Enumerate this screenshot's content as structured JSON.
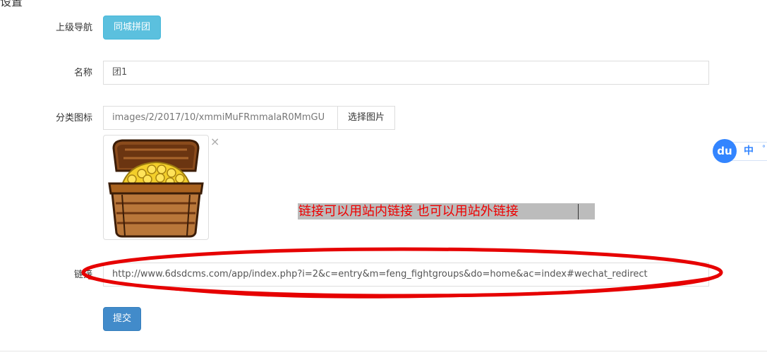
{
  "section": {
    "title": "设置"
  },
  "form": {
    "parent_nav": {
      "label": "上级导航",
      "value": "同城拼团"
    },
    "name": {
      "label": "名称",
      "value": "团1"
    },
    "category_icon": {
      "label": "分类图标",
      "value": "images/2/2017/10/xmmiMuFRmmaIaR0MmGU",
      "select_button": "选择图片",
      "remove_symbol": "×",
      "image_icon": "treasure-chest-icon"
    },
    "link": {
      "label": "链接",
      "value": "http://www.6dsdcms.com/app/index.php?i=2&c=entry&m=feng_fightgroups&do=home&ac=index#wechat_redirect"
    },
    "submit_button": "提交"
  },
  "annotation": {
    "note": "链接可以用站内链接 也可以用站外链接",
    "note_color": "#e00000",
    "oval_color": "#e60000"
  },
  "ime_widget": {
    "logo": "du",
    "lang": "中",
    "dot": "°"
  },
  "colors": {
    "info": "#5bc0de",
    "primary": "#428bca",
    "border": "#dddddd"
  }
}
